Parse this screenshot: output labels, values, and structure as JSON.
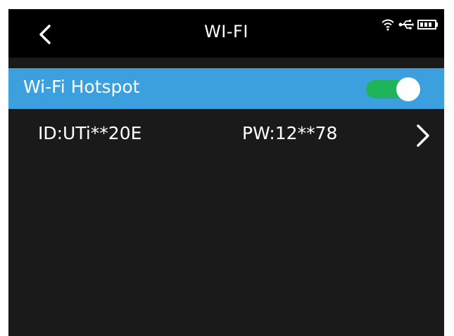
{
  "header": {
    "title": "WI-FI",
    "back_icon": "chevron-left-icon"
  },
  "status_bar": {
    "icons": [
      "wifi-icon",
      "usb-icon",
      "battery-icon"
    ]
  },
  "hotspot": {
    "label": "Wi-Fi Hotspot",
    "enabled": true,
    "accent_color": "#3da0de",
    "toggle_on_color": "#1fb35a"
  },
  "credentials": {
    "id": "ID:UTi**20E",
    "password": "PW:12**78",
    "chevron_icon": "chevron-right-icon"
  }
}
